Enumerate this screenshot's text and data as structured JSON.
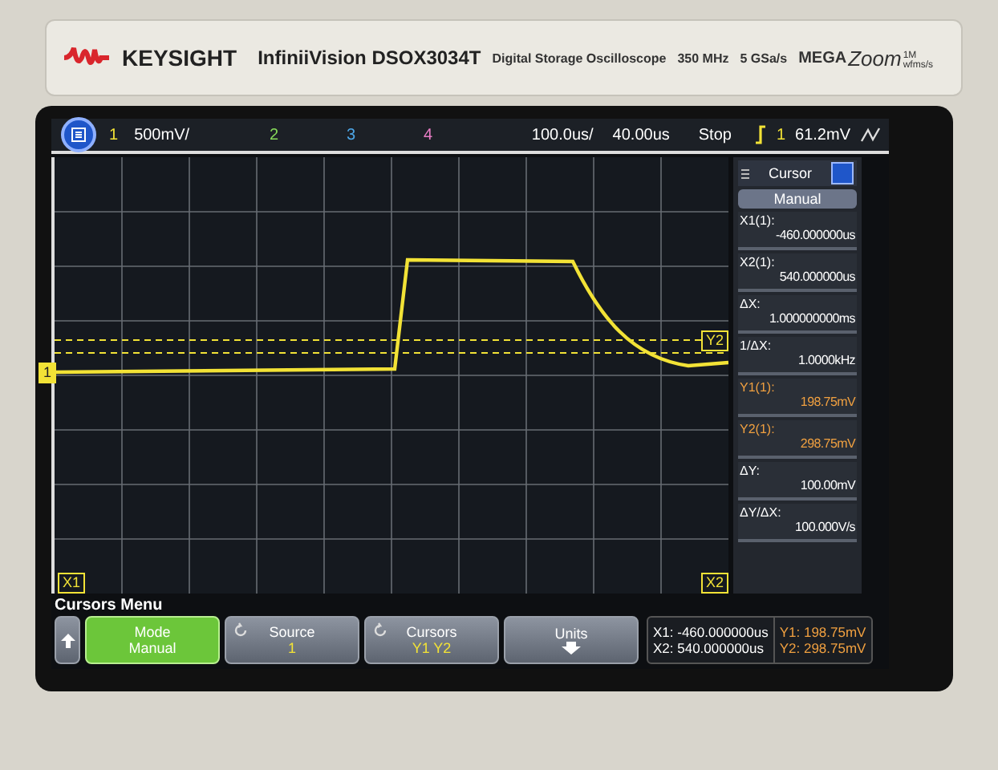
{
  "brand": {
    "name": "KEYSIGHT",
    "model": "InfiniiVision DSOX3034T",
    "description": "Digital Storage Oscilloscope",
    "bandwidth": "350 MHz",
    "sample_rate": "5 GSa/s",
    "zoom_logo": {
      "mega": "MEGA",
      "zoom": "Zoom",
      "rate": "1M wfms/s"
    }
  },
  "status_bar": {
    "channels": [
      {
        "label": "1",
        "scale": "500mV/",
        "color": "#f2e236"
      },
      {
        "label": "2",
        "color": "#86d95a"
      },
      {
        "label": "3",
        "color": "#4da6e6"
      },
      {
        "label": "4",
        "color": "#e77cc4"
      }
    ],
    "timebase": "100.0us/",
    "delay": "40.00us",
    "run_state": "Stop",
    "trigger": {
      "source": "1",
      "level": "61.2mV"
    }
  },
  "plot": {
    "markers": [
      {
        "kind": "ground",
        "label": "1"
      },
      {
        "kind": "y",
        "label": "Y2"
      },
      {
        "kind": "x",
        "label": "X1"
      },
      {
        "kind": "x",
        "label": "X2"
      }
    ]
  },
  "cursor_panel": {
    "title": "Cursor",
    "mode": "Manual",
    "readings": [
      {
        "label": "X1(1):",
        "value": "-460.000000us",
        "color": "#ffffff"
      },
      {
        "label": "X2(1):",
        "value": "540.000000us",
        "color": "#ffffff"
      },
      {
        "label": "ΔX:",
        "value": "1.000000000ms",
        "color": "#ffffff"
      },
      {
        "label": "1/ΔX:",
        "value": "1.0000kHz",
        "color": "#ffffff"
      },
      {
        "label": "Y1(1):",
        "value": "198.75mV",
        "color": "#f0a040"
      },
      {
        "label": "Y2(1):",
        "value": "298.75mV",
        "color": "#f0a040"
      },
      {
        "label": "ΔY:",
        "value": "100.00mV",
        "color": "#ffffff"
      },
      {
        "label": "ΔY/ΔX:",
        "value": "100.000V/s",
        "color": "#ffffff"
      }
    ]
  },
  "softkeys": {
    "menu_title": "Cursors Menu",
    "buttons": [
      {
        "kind": "back",
        "selected": false
      },
      {
        "kind": "toggle",
        "label": "Mode",
        "value": "Manual",
        "selected": true
      },
      {
        "kind": "cycle",
        "label": "Source",
        "value": "1",
        "selected": false
      },
      {
        "kind": "cycle",
        "label": "Cursors",
        "value": "Y1 Y2",
        "selected": false
      },
      {
        "kind": "submenu",
        "label": "Units",
        "selected": false
      }
    ],
    "readout": [
      {
        "text": "X1: -460.000000us",
        "color": "#ffffff"
      },
      {
        "text": "X2: 540.000000us",
        "color": "#ffffff"
      },
      {
        "text": "Y1: 198.75mV",
        "color": "#f0a040"
      },
      {
        "text": "Y2: 298.75mV",
        "color": "#f0a040"
      }
    ]
  }
}
